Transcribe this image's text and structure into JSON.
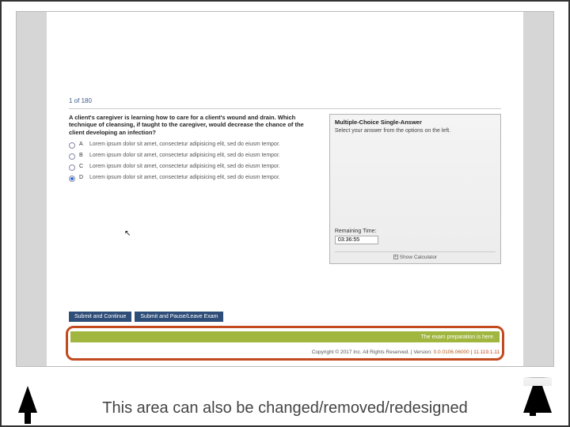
{
  "progress": "1 of 180",
  "question": "A client's caregiver is learning how to care for a client's wound and drain. Which technique of cleansing, if taught to the caregiver, would decrease the chance of the client developing an infection?",
  "options": [
    {
      "letter": "A",
      "text": "Lorem ipsum dolor sit amet, consectetur adipisicing elit, sed do eiusm tempor.",
      "selected": false
    },
    {
      "letter": "B",
      "text": "Lorem ipsum dolor sit amet, consectetur adipisicing elit, sed do eiusm tempor.",
      "selected": false
    },
    {
      "letter": "C",
      "text": "Lorem ipsum dolor sit amet, consectetur adipisicing elit, sed do eiusm tempor.",
      "selected": false
    },
    {
      "letter": "D",
      "text": "Lorem ipsum dolor sit amet, consectetur adipisicing elit, sed do eiusm tempor.",
      "selected": true
    }
  ],
  "sidebar": {
    "title": "Multiple-Choice Single-Answer",
    "instruction": "Select your answer from the options on the left.",
    "remaining_label": "Remaining Time:",
    "remaining_value": "03:36:55",
    "calculator": "Show Calculator"
  },
  "buttons": {
    "submit_continue": "Submit and Continue",
    "submit_pause": "Submit and Pause/Leave Exam"
  },
  "banner": "The exam preparation is here.",
  "copyright": "Copyright © 2017 Inc. All Rights Reserved. | Version: ",
  "version": "0.0.0106.06000",
  "ip": "11.119.1.11",
  "annotation": "This area can also be changed/removed/redesigned"
}
